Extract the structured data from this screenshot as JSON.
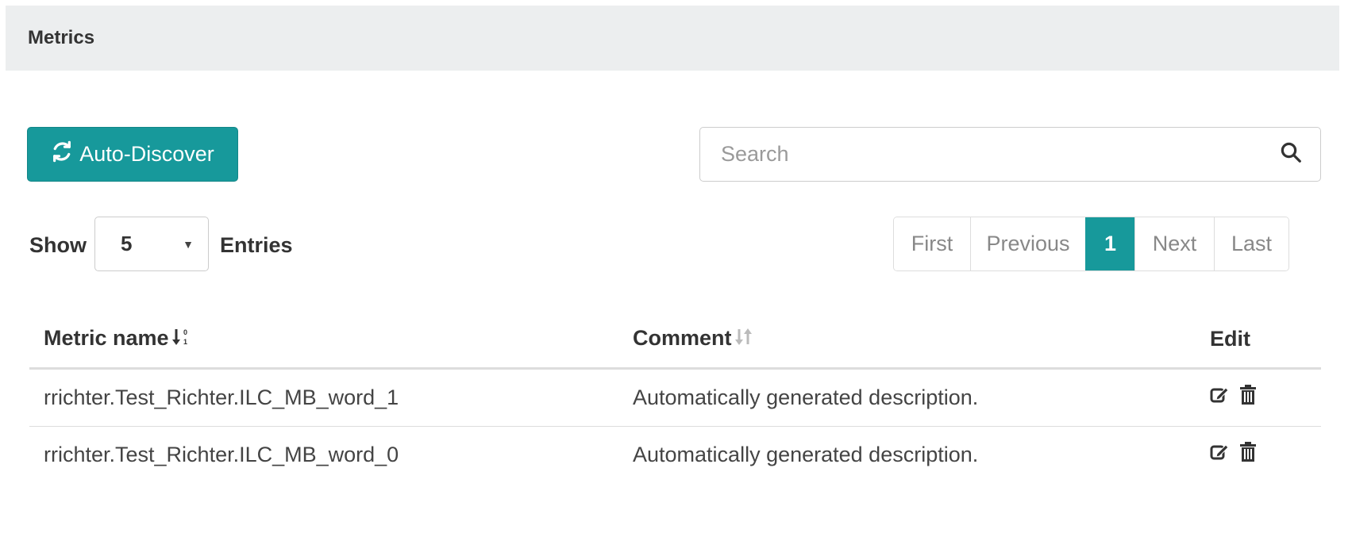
{
  "panel": {
    "title": "Metrics"
  },
  "toolbar": {
    "auto_discover_label": "Auto-Discover",
    "auto_discover_icon": "refresh-icon",
    "search_placeholder": "Search",
    "search_icon": "search-icon"
  },
  "length_control": {
    "show_label": "Show",
    "selected_value": "5",
    "entries_label": "Entries"
  },
  "pagination": {
    "first": "First",
    "previous": "Previous",
    "current": "1",
    "next": "Next",
    "last": "Last"
  },
  "table": {
    "headers": {
      "name": "Metric name",
      "comment": "Comment",
      "edit": "Edit"
    },
    "rows": [
      {
        "name": "rrichter.Test_Richter.ILC_MB_word_1",
        "comment": "Automatically generated description."
      },
      {
        "name": "rrichter.Test_Richter.ILC_MB_word_0",
        "comment": "Automatically generated description."
      }
    ]
  },
  "colors": {
    "accent": "#17999b",
    "header_bg": "#eceeef"
  }
}
